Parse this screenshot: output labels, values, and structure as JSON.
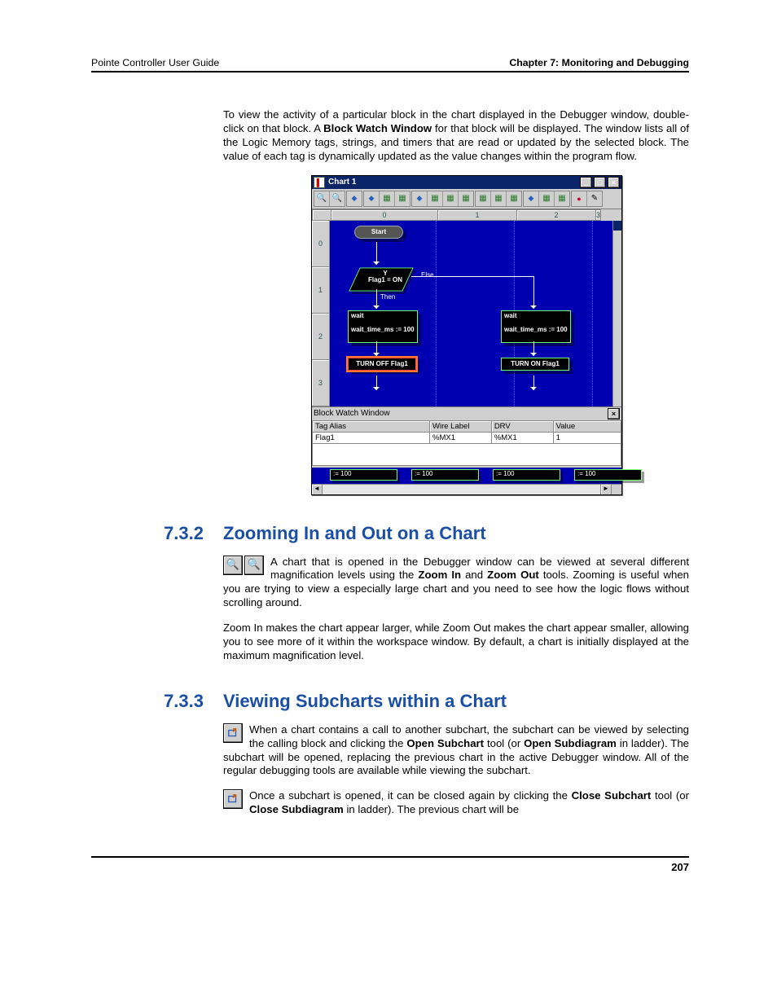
{
  "header": {
    "left": "Pointe Controller User Guide",
    "right": "Chapter 7: Monitoring and Debugging"
  },
  "page_number": "207",
  "intro_para": {
    "pre": "To view the activity of a particular block in the chart displayed in the Debugger window, double-click on that block.  A ",
    "bold1": "Block Watch Window",
    "post": " for that block will be displayed. The window lists all of the Logic Memory tags, strings, and timers that are read or updated by the selected block. The value of each tag is dynamically updated as the value changes within the program flow."
  },
  "section_732": {
    "num": "7.3.2",
    "title": "Zooming In and Out on a Chart",
    "p1_pre": "A chart that is opened in the Debugger window can be viewed at several different magnification levels using the ",
    "p1_b1": "Zoom In",
    "p1_mid": " and ",
    "p1_b2": "Zoom Out",
    "p1_post": " tools. Zooming is useful when you are trying to view a especially large chart and you need to see how the logic flows without scrolling around.",
    "p2": "Zoom In makes the chart appear larger, while Zoom Out makes the chart appear smaller, allowing you to see more of it within the workspace window. By default, a chart is initially displayed at the maximum magnification level."
  },
  "section_733": {
    "num": "7.3.3",
    "title": "Viewing Subcharts within a Chart",
    "p1_pre": "When a chart contains a call to another subchart, the subchart can be viewed by selecting the calling block and clicking the ",
    "p1_b1": "Open Subchart",
    "p1_mid1": " tool (or ",
    "p1_b2": "Open Subdiagram",
    "p1_post": " in ladder). The subchart will be opened, replacing the previous chart in the active Debugger window. All of the regular debugging tools are available while viewing the subchart.",
    "p2_pre": "Once a subchart is opened, it can be closed again by clicking the ",
    "p2_b1": "Close Subchart",
    "p2_mid": " tool (or ",
    "p2_b2": "Close Subdiagram",
    "p2_post": " in ladder). The previous chart will be"
  },
  "figure": {
    "title": "Chart 1",
    "col_headers": [
      "0",
      "1",
      "2",
      "3"
    ],
    "row_headers": [
      "0",
      "1",
      "2",
      "3"
    ],
    "blocks": {
      "start": "Start",
      "decision_top": "Y",
      "decision": "Flag1 =  ON",
      "else": "Else",
      "then": "Then",
      "wait_left_title": "wait",
      "wait_left_body": "wait_time_ms := 100",
      "wait_right_title": "wait",
      "wait_right_body": "wait_time_ms := 100",
      "turn_off": "TURN OFF Flag1",
      "turn_on": "TURN ON Flag1"
    },
    "watch": {
      "title": "Block Watch Window",
      "headers": [
        "Tag Alias",
        "Wire Label",
        "DRV",
        "Value"
      ],
      "row": [
        "Flag1",
        "%MX1",
        "%MX1",
        "1"
      ]
    },
    "strip_labels": [
      ":= 100",
      ":= 100",
      ":= 100",
      ":= 100"
    ]
  }
}
